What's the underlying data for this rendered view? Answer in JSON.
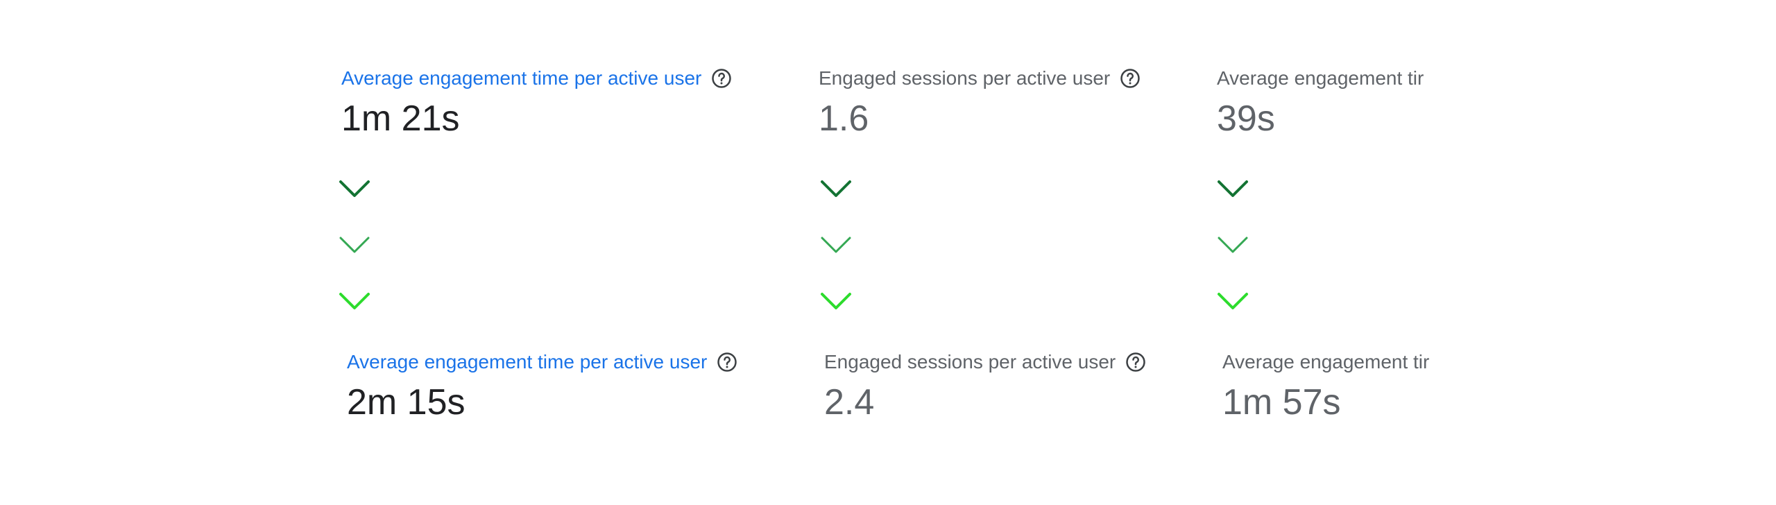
{
  "row1": {
    "metric1": {
      "label": "Average engagement time per active user",
      "value": "1m 21s"
    },
    "metric2": {
      "label": "Engaged sessions per active user",
      "value": "1.6"
    },
    "metric3": {
      "label": "Average engagement tir",
      "value": "39s"
    }
  },
  "row2": {
    "metric1": {
      "label": "Average engagement time per active user",
      "value": "2m 15s"
    },
    "metric2": {
      "label": "Engaged sessions per active user",
      "value": "2.4"
    },
    "metric3": {
      "label": "Average engagement tir",
      "value": "1m 57s"
    }
  },
  "icons": {
    "help": "help-circle-icon",
    "chevron": "chevron-down-icon"
  },
  "colors": {
    "active_label": "#1a73e8",
    "muted_label": "#5f6368",
    "active_value": "#202124",
    "chevron_dark": "#137333",
    "chevron_mid": "#34a853",
    "chevron_light": "#2ddc2d"
  }
}
